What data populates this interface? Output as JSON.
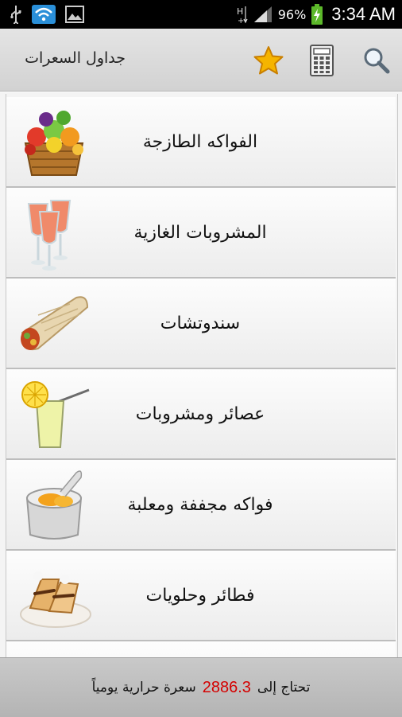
{
  "status_bar": {
    "battery_percent": "96%",
    "time": "3:34 AM",
    "icons": [
      "usb-icon",
      "wifi-icon",
      "image-icon",
      "hplus-icon",
      "signal-icon",
      "battery-icon"
    ]
  },
  "action_bar": {
    "title": "جداول السعرات",
    "icons": [
      "favorite-star-icon",
      "calculator-icon",
      "search-icon"
    ]
  },
  "categories": [
    {
      "label": "الفواكه الطازجة",
      "icon": "fruit-basket-icon"
    },
    {
      "label": "المشروبات الغازية",
      "icon": "soft-drinks-icon"
    },
    {
      "label": "سندوتشات",
      "icon": "sandwich-wrap-icon"
    },
    {
      "label": "عصائر ومشروبات",
      "icon": "lemonade-juice-icon"
    },
    {
      "label": "فواكه مجففة ومعلبة",
      "icon": "canned-fruit-icon"
    },
    {
      "label": "فطائر وحلويات",
      "icon": "pastry-dessert-icon"
    }
  ],
  "footer": {
    "prefix": "تحتاج إلى",
    "value": "2886.3",
    "suffix": "سعرة حرارية يومياً"
  },
  "colors": {
    "accent_value": "#d40000",
    "star": "#f5b400"
  }
}
